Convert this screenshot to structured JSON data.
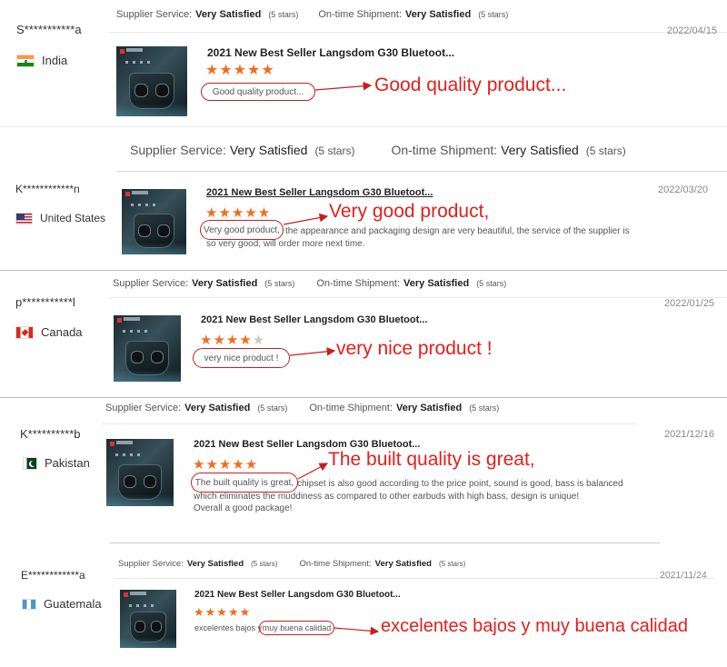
{
  "product_title": "2021 New Best Seller Langsdom G30 Bluetoot...",
  "reviews": [
    {
      "supplier_label": "Supplier Service:",
      "supplier_value": "Very Satisfied",
      "supplier_stars": "(5 stars)",
      "shipment_label": "On-time Shipment:",
      "shipment_value": "Very Satisfied",
      "shipment_stars": "(5 stars)",
      "user": "S***********a",
      "country": "India",
      "date": "2022/04/15",
      "rating": 5,
      "text": "Good quality product...",
      "highlight": "Good quality product...",
      "annotation": "Good quality product..."
    },
    {
      "supplier_label": "Supplier Service:",
      "supplier_value": "Very Satisfied",
      "supplier_stars": "(5 stars)",
      "shipment_label": "On-time Shipment:",
      "shipment_value": "Very Satisfied",
      "shipment_stars": "(5 stars)",
      "user": "K************n",
      "country": "United States",
      "date": "2022/03/20",
      "rating": 5,
      "text_rest": "the appearance and packaging design are very beautiful, the service of the supplier is so very good, will order more next time.",
      "highlight": "Very good product,",
      "annotation": "Very good product,"
    },
    {
      "supplier_label": "Supplier Service:",
      "supplier_value": "Very Satisfied",
      "supplier_stars": "(5 stars)",
      "shipment_label": "On-time Shipment:",
      "shipment_value": "Very Satisfied",
      "shipment_stars": "(5 stars)",
      "user": "p***********l",
      "country": "Canada",
      "date": "2022/01/25",
      "rating": 4,
      "highlight": "very nice product !",
      "annotation": "very nice product !"
    },
    {
      "supplier_label": "Supplier Service:",
      "supplier_value": "Very Satisfied",
      "supplier_stars": "(5 stars)",
      "shipment_label": "On-time Shipment:",
      "shipment_value": "Very Satisfied",
      "shipment_stars": "(5 stars)",
      "user": "K**********b",
      "country": "Pakistan",
      "date": "2021/12/16",
      "rating": 5,
      "highlight": "The built quality is great,",
      "text_rest_line1": "chipset is also good according to the price point, sound is good, bass is balanced",
      "text_line2": "which eliminates the muddiness as compared to other earbuds with high bass, design is unique!",
      "text_line3": "Overall a good package!",
      "annotation": "The built quality is great,"
    },
    {
      "supplier_label": "Supplier Service:",
      "supplier_value": "Very Satisfied",
      "supplier_stars": "(5 stars)",
      "shipment_label": "On-time Shipment:",
      "shipment_value": "Very Satisfied",
      "shipment_stars": "(5 stars)",
      "user": "E************a",
      "country": "Guatemala",
      "date": "2021/11/24",
      "rating": 5,
      "text_prefix": "excelentes bajos y",
      "highlight": "muy buena calidad",
      "annotation": "excelentes bajos y muy buena calidad"
    }
  ],
  "colors": {
    "star": "#f26c1d",
    "annotation": "#e0201c",
    "oval": "#c81e1e"
  },
  "icons": [
    "india-flag-icon",
    "us-flag-icon",
    "canada-flag-icon",
    "pakistan-flag-icon",
    "guatemala-flag-icon",
    "star-icon",
    "arrow-icon"
  ]
}
